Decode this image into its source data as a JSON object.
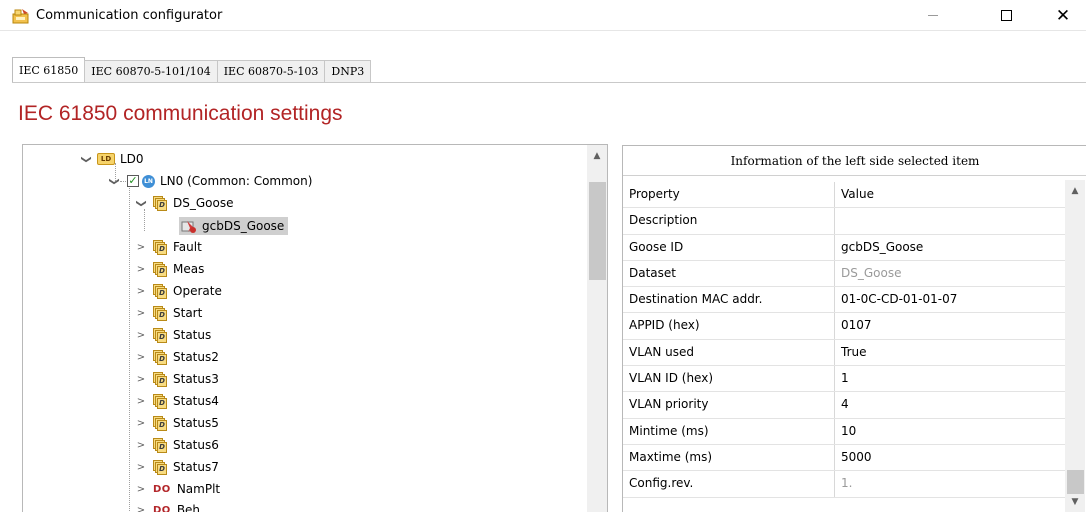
{
  "window": {
    "title": "Communication configurator",
    "icons": {
      "app": "configurator-app-icon",
      "minimize": "minimize-icon",
      "maximize": "maximize-icon",
      "close": "close-icon"
    }
  },
  "tabs": [
    {
      "label": "IEC 61850",
      "active": true
    },
    {
      "label": "IEC 60870-5-101/104",
      "active": false
    },
    {
      "label": "IEC 60870-5-103",
      "active": false
    },
    {
      "label": "DNP3",
      "active": false
    }
  ],
  "heading": "IEC 61850 communication settings",
  "colors": {
    "heading": "#b22425",
    "selection": "#cfcfcf",
    "do_label": "#b3262a"
  },
  "tree": {
    "ld": {
      "badge": "LD",
      "label": "LD0",
      "expanded": true
    },
    "ln": {
      "badge": "LN",
      "label": "LN0 (Common: Common)",
      "checked": true,
      "expanded": true
    },
    "goose_dataset": {
      "label": "DS_Goose",
      "expanded": true
    },
    "goose_control": {
      "label": "gcbDS_Goose",
      "selected": true
    },
    "datasets": [
      "Fault",
      "Meas",
      "Operate",
      "Start",
      "Status",
      "Status2",
      "Status3",
      "Status4",
      "Status5",
      "Status6",
      "Status7"
    ],
    "data_objects": [
      {
        "badge": "DO",
        "label": "NamPlt"
      },
      {
        "badge": "DO",
        "label": "Beh"
      }
    ],
    "dataset_badge": "D"
  },
  "info": {
    "title": "Information of the left side selected item",
    "columns": [
      "Property",
      "Value"
    ],
    "rows": [
      {
        "property": "Description",
        "value": "",
        "muted": false
      },
      {
        "property": "Goose ID",
        "value": "gcbDS_Goose",
        "muted": false
      },
      {
        "property": "Dataset",
        "value": "DS_Goose",
        "muted": true
      },
      {
        "property": "Destination MAC addr.",
        "value": "01-0C-CD-01-01-07",
        "muted": false
      },
      {
        "property": "APPID (hex)",
        "value": "0107",
        "muted": false
      },
      {
        "property": "VLAN used",
        "value": "True",
        "muted": false
      },
      {
        "property": "VLAN ID (hex)",
        "value": "1",
        "muted": false
      },
      {
        "property": "VLAN priority",
        "value": "4",
        "muted": false
      },
      {
        "property": "Mintime (ms)",
        "value": "10",
        "muted": false
      },
      {
        "property": "Maxtime (ms)",
        "value": "5000",
        "muted": false
      },
      {
        "property": "Config.rev.",
        "value": "1.",
        "muted": true
      }
    ]
  }
}
